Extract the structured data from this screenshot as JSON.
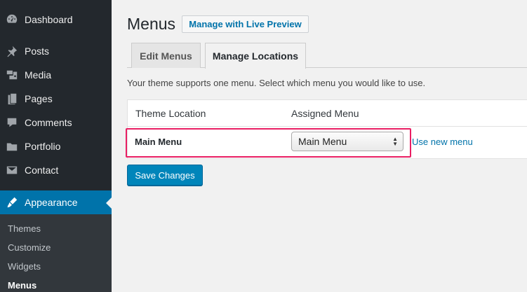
{
  "sidebar": {
    "items": [
      {
        "label": "Dashboard",
        "icon": "dashboard-icon"
      },
      {
        "label": "Posts",
        "icon": "pin-icon"
      },
      {
        "label": "Media",
        "icon": "media-icon"
      },
      {
        "label": "Pages",
        "icon": "pages-icon"
      },
      {
        "label": "Comments",
        "icon": "comment-icon"
      },
      {
        "label": "Portfolio",
        "icon": "folder-icon"
      },
      {
        "label": "Contact",
        "icon": "envelope-icon"
      },
      {
        "label": "Appearance",
        "icon": "brush-icon",
        "active": true
      }
    ],
    "submenu": [
      "Themes",
      "Customize",
      "Widgets",
      "Menus"
    ],
    "current_submenu": "Menus",
    "colors": {
      "background": "#23282d",
      "active": "#0073aa"
    }
  },
  "header": {
    "title": "Menus",
    "live_preview_label": "Manage with Live Preview"
  },
  "tabs": [
    {
      "label": "Edit Menus",
      "active": false
    },
    {
      "label": "Manage Locations",
      "active": true
    }
  ],
  "main": {
    "intro": "Your theme supports one menu. Select which menu you would like to use.",
    "table": {
      "headers": [
        "Theme Location",
        "Assigned Menu"
      ],
      "row": {
        "location": "Main Menu",
        "selected_menu": "Main Menu",
        "link_label": "Use new menu"
      }
    },
    "save_label": "Save Changes",
    "highlight_color": "#e91e63"
  }
}
